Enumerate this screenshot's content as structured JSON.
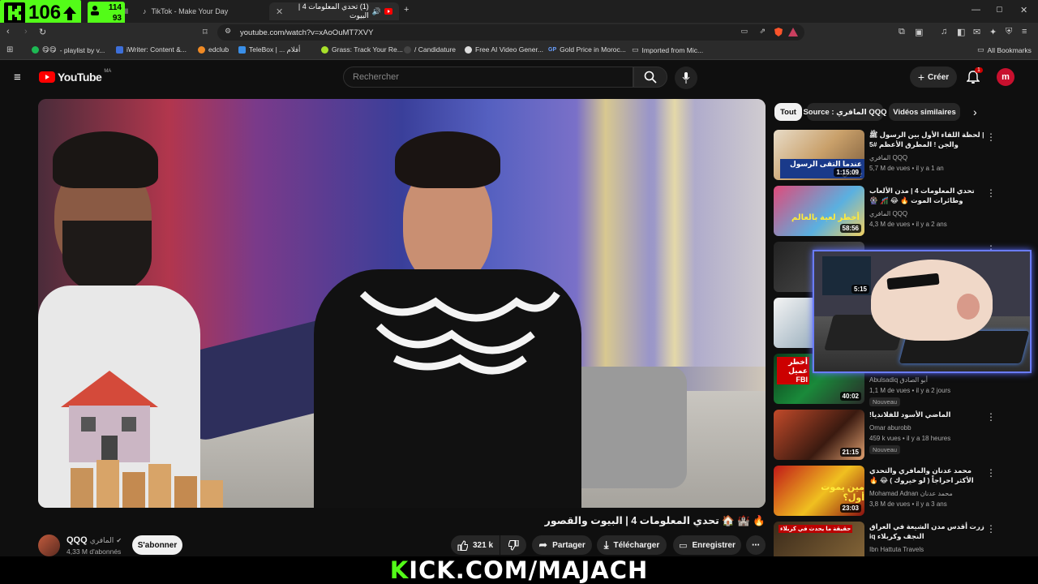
{
  "overlay": {
    "kick_counter": "106",
    "viewers_top": "114",
    "viewers_bottom": "93",
    "banner": "KICK.COM/MAJACH"
  },
  "browser": {
    "tabs": [
      {
        "label": "TikTok - Make Your Day"
      },
      {
        "label": "(1) تحدي المعلومات 4 | البيوت"
      }
    ],
    "tab_fragment": "ill",
    "url": "youtube.com/watch?v=xAoOuMT7XVY",
    "bookmarks": [
      {
        "label": "- playlist by v..."
      },
      {
        "label": "iWriter: Content &..."
      },
      {
        "label": "edclub"
      },
      {
        "label": "TeleBox | ... أفلام"
      },
      {
        "label": "Grass: Track Your Re..."
      },
      {
        "label": "/ Candidature"
      },
      {
        "label": "Free AI Video Gener..."
      },
      {
        "label": "Gold Price in Moroc..."
      },
      {
        "label": "Imported from Mic..."
      },
      {
        "label": "All Bookmarks"
      }
    ],
    "bookmark_gp": "GP"
  },
  "youtube": {
    "logo": "YouTube",
    "region": "MA",
    "search_placeholder": "Rechercher",
    "create_label": "Créer",
    "notification_count": "1",
    "video": {
      "title": "🔥 🏰 🏠 تحدي المعلومات 4 | البيوت والقصور",
      "channel": "QQQ",
      "channel_ar": "المافري",
      "subscribers": "4,33 M d'abonnés",
      "subscribe_label": "S'abonner",
      "likes": "321 k",
      "share_label": "Partager",
      "download_label": "Télécharger",
      "save_label": "Enregistrer"
    },
    "chips": [
      {
        "label": "Tout"
      },
      {
        "label": "Source : المافري QQQ"
      },
      {
        "label": "Vidéos similaires"
      }
    ],
    "recommendations": [
      {
        "title": "| لحظة اللقاء الأول بين الرسول ﷺ والجن ! المطرق الأعظم #5",
        "channel": "المافري QQQ",
        "meta": "5,7 M de vues • il y a 1 an",
        "duration": "1:15:09",
        "thumb_text": "عندما التقى الرسول بالجن"
      },
      {
        "title": "تحدي المعلومات 4 | مدن الألعاب وطائرات الموت 🔥 😂 🎢 🎡",
        "channel": "المافري QQQ",
        "meta": "4,3 M de vues • il y a 2 ans",
        "duration": "58:56",
        "thumb_text": "أخطر لعبة بالعالم"
      },
      {
        "title": "",
        "channel": "",
        "meta": "",
        "duration": "5:15",
        "thumb_text": ""
      },
      {
        "title": "",
        "channel": "",
        "meta": "",
        "duration": "",
        "thumb_text": ""
      },
      {
        "title": "",
        "channel": "Abulsadiq أبو الصادق",
        "meta": "1,1 M de vues • il y a 2 jours",
        "duration": "40:02",
        "badge": "Nouveau",
        "thumb_text": "أخطر عميل FBI"
      },
      {
        "title": "الماضي الأسود للفلانديا!",
        "channel": "Omar aburobb",
        "meta": "459 k vues • il y a 18 heures",
        "duration": "21:15",
        "badge": "Nouveau",
        "thumb_text": ""
      },
      {
        "title": "محمد عدنان والمافري والتحدي الأكثر احراجاً ( لو خيروك ) 😂 🔥",
        "channel": "Mohamad Adnan محمد عدنان",
        "meta": "3,8 M de vues • il y a 3 ans",
        "duration": "23:03",
        "thumb_text": "مين يموت أول؟"
      },
      {
        "title": "زرت أقدس مدن الشيعة في العراق النجف وكربلاء iq",
        "channel": "Ibn Hattuta Travels",
        "meta": "",
        "duration": "",
        "thumb_text": "حقيقة ما يحدث في كربلاء"
      }
    ]
  },
  "colors": {
    "kick_green": "#53fc18",
    "yt_red": "#ff0000",
    "bg": "#0f0f0f"
  }
}
